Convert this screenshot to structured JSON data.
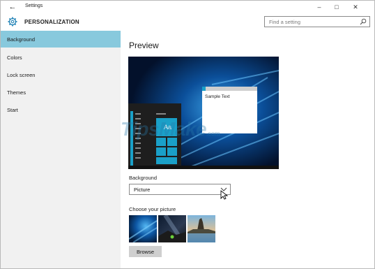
{
  "window": {
    "title": "Settings",
    "controls": [
      "minimize-icon",
      "maximize-icon",
      "close-icon"
    ]
  },
  "header": {
    "section_title": "PERSONALIZATION",
    "search_placeholder": "Find a setting"
  },
  "sidebar": {
    "items": [
      {
        "label": "Background",
        "active": true
      },
      {
        "label": "Colors",
        "active": false
      },
      {
        "label": "Lock screen",
        "active": false
      },
      {
        "label": "Themes",
        "active": false
      },
      {
        "label": "Start",
        "active": false
      }
    ]
  },
  "main": {
    "title": "Preview",
    "preview_sample_text": "Sample Text",
    "preview_tile_text": "Aa",
    "background_label": "Background",
    "background_value": "Picture",
    "choose_label": "Choose your picture",
    "browse_label": "Browse"
  },
  "watermark": {
    "text": "TipsMake",
    "suffix": ".com"
  },
  "colors": {
    "accent": "#88c9dd",
    "sidebar_bg": "#f1f1f1",
    "tile_blue": "#1aa0c8"
  }
}
